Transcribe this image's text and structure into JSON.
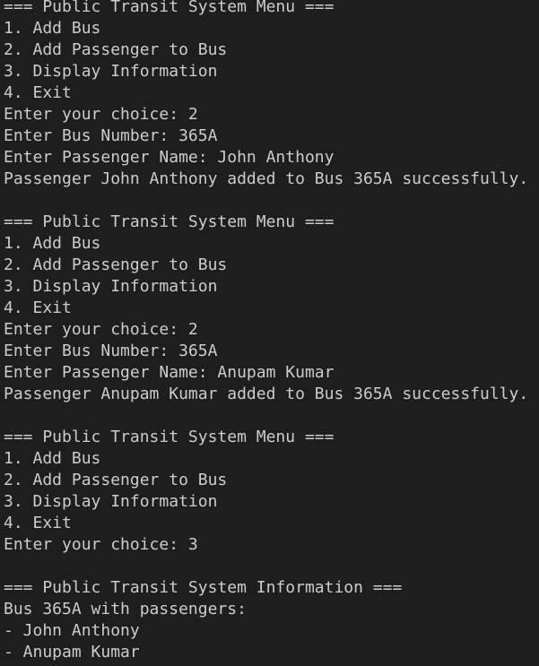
{
  "terminal": {
    "lines": [
      "=== Public Transit System Menu ===",
      "1. Add Bus",
      "2. Add Passenger to Bus",
      "3. Display Information",
      "4. Exit",
      "Enter your choice: 2",
      "Enter Bus Number: 365A",
      "Enter Passenger Name: John Anthony",
      "Passenger John Anthony added to Bus 365A successfully.",
      "",
      "=== Public Transit System Menu ===",
      "1. Add Bus",
      "2. Add Passenger to Bus",
      "3. Display Information",
      "4. Exit",
      "Enter your choice: 2",
      "Enter Bus Number: 365A",
      "Enter Passenger Name: Anupam Kumar",
      "Passenger Anupam Kumar added to Bus 365A successfully.",
      "",
      "=== Public Transit System Menu ===",
      "1. Add Bus",
      "2. Add Passenger to Bus",
      "3. Display Information",
      "4. Exit",
      "Enter your choice: 3",
      "",
      "=== Public Transit System Information ===",
      "Bus 365A with passengers:",
      "- John Anthony",
      "- Anupam Kumar"
    ]
  }
}
